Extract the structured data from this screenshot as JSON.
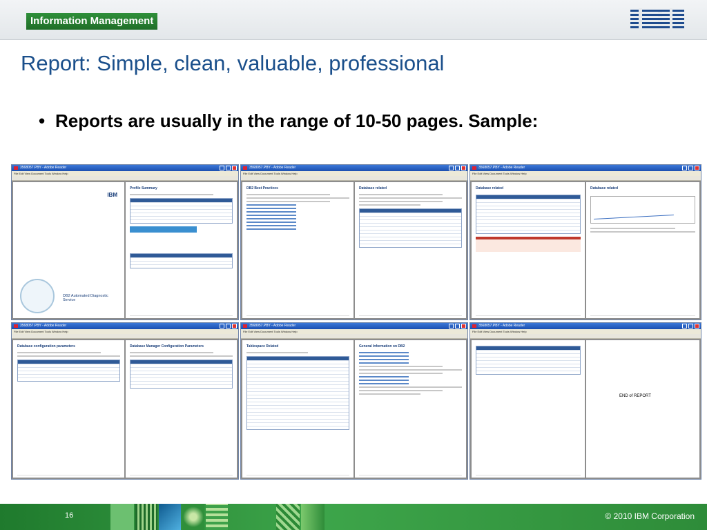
{
  "header": {
    "badge": "Information Management",
    "logo_text": "IBM"
  },
  "slide": {
    "title": "Report: Simple, clean, valuable, professional",
    "bullet": "Reports are usually in the range of 10-50 pages. Sample:",
    "bullet_mark": "•"
  },
  "thumbnails": [
    {
      "window_title": "3568057.PBY - Adobe Reader",
      "left_heading": "",
      "right_heading": "Profile Summary",
      "left_caption": "DB2 Automated Diagnostic Service"
    },
    {
      "window_title": "3568057.PBY - Adobe Reader",
      "left_heading": "DB2 Best Practices",
      "right_heading": "Database related"
    },
    {
      "window_title": "3568057.PBY - Adobe Reader",
      "left_heading": "Database related",
      "right_heading": "Database related"
    },
    {
      "window_title": "3568057.PBY - Adobe Reader",
      "left_heading": "Database configuration parameters",
      "right_heading": "Database Manager Configuration Parameters"
    },
    {
      "window_title": "3568057.PBY - Adobe Reader",
      "left_heading": "Tablespace Related",
      "right_heading": "General Information on DB2"
    },
    {
      "window_title": "3568057.PBY - Adobe Reader",
      "left_heading": "",
      "right_heading": "",
      "right_caption": "END of REPORT"
    }
  ],
  "menu_text": "File  Edit  View  Document  Tools  Window  Help",
  "footer": {
    "page_number": "16",
    "copyright": "© 2010  IBM Corporation"
  },
  "colors": {
    "title_blue": "#1a4f8b",
    "brand_green": "#2f8f3a",
    "footer_green": "#1f7a2d"
  }
}
